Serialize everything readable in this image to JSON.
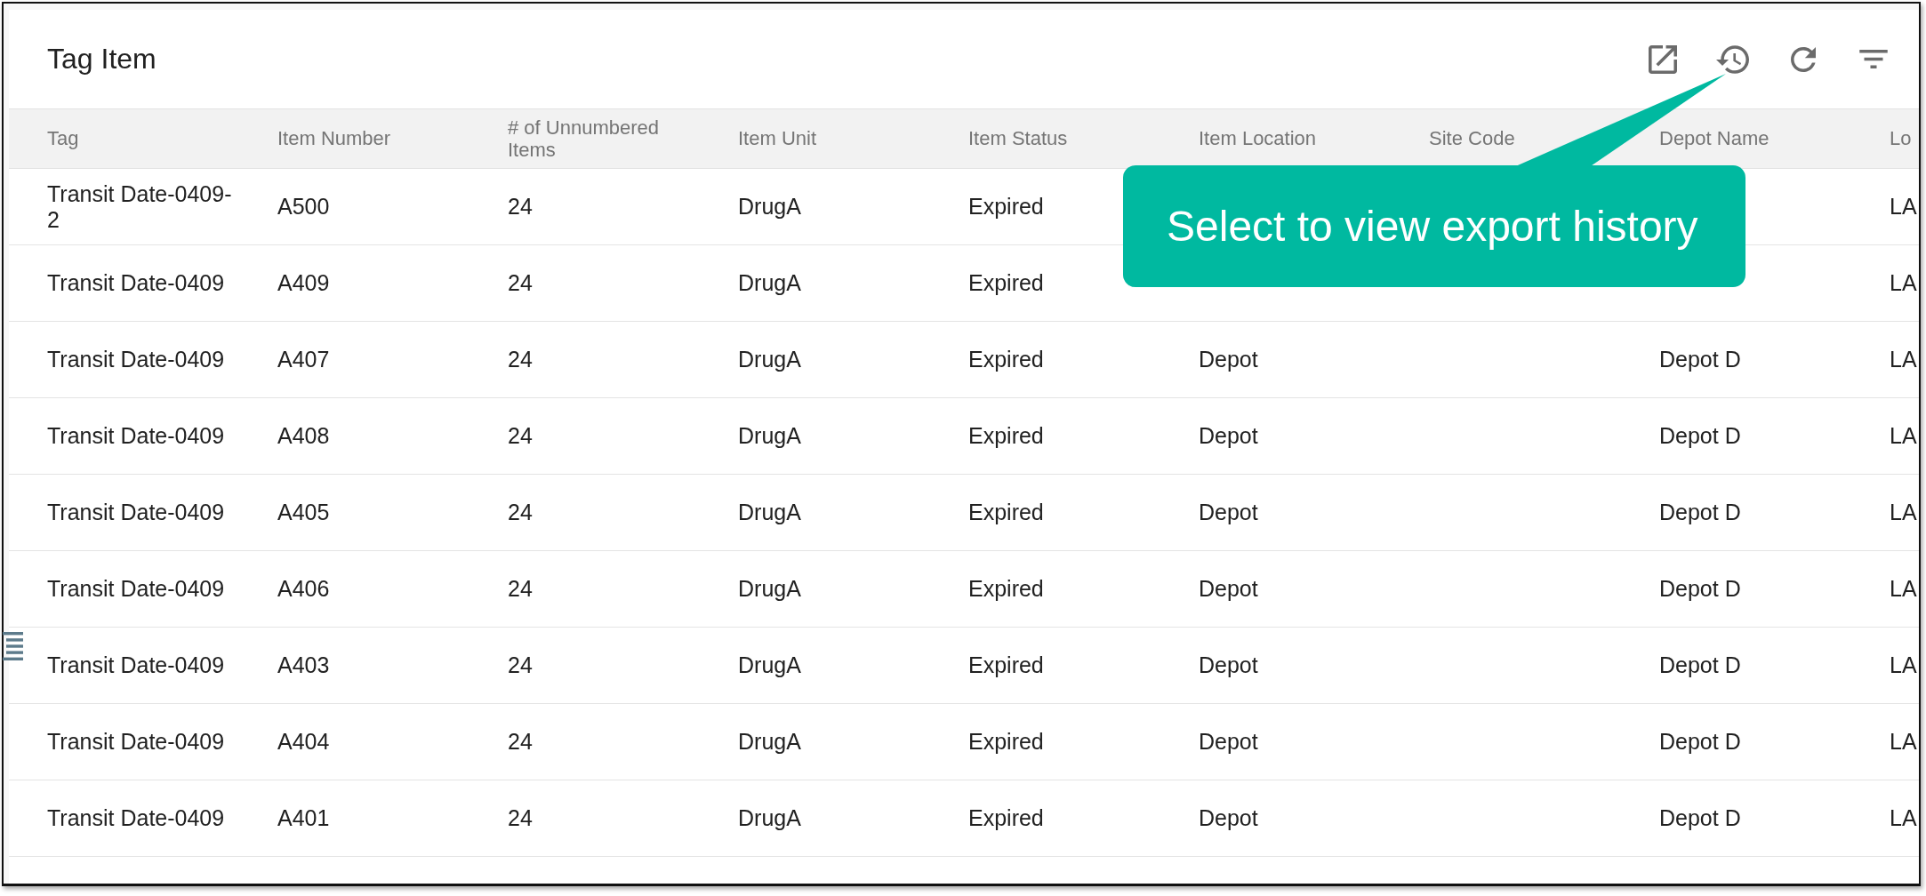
{
  "panel": {
    "title": "Tag Item"
  },
  "table": {
    "columns": [
      "Tag",
      "Item Number",
      "# of Unnumbered Items",
      "Item Unit",
      "Item Status",
      "Item Location",
      "Site Code",
      "Depot Name",
      "Lo"
    ],
    "rows": [
      {
        "tag": "Transit Date-0409-2",
        "item_number": "A500",
        "unnumbered_items": "24",
        "item_unit": "DrugA",
        "item_status": "Expired",
        "column_9": "LA"
      },
      {
        "tag": "Transit Date-0409",
        "item_number": "A409",
        "unnumbered_items": "24",
        "item_unit": "DrugA",
        "item_status": "Expired",
        "column_9": "LA"
      },
      {
        "tag": "Transit Date-0409",
        "item_number": "A407",
        "unnumbered_items": "24",
        "item_unit": "DrugA",
        "item_status": "Expired",
        "item_location": "Depot",
        "depot_name": "Depot D",
        "column_9": "LA"
      },
      {
        "tag": "Transit Date-0409",
        "item_number": "A408",
        "unnumbered_items": "24",
        "item_unit": "DrugA",
        "item_status": "Expired",
        "item_location": "Depot",
        "depot_name": "Depot D",
        "column_9": "LA"
      },
      {
        "tag": "Transit Date-0409",
        "item_number": "A405",
        "unnumbered_items": "24",
        "item_unit": "DrugA",
        "item_status": "Expired",
        "item_location": "Depot",
        "depot_name": "Depot D",
        "column_9": "LA"
      },
      {
        "tag": "Transit Date-0409",
        "item_number": "A406",
        "unnumbered_items": "24",
        "item_unit": "DrugA",
        "item_status": "Expired",
        "item_location": "Depot",
        "depot_name": "Depot D",
        "column_9": "LA"
      },
      {
        "tag": "Transit Date-0409",
        "item_number": "A403",
        "unnumbered_items": "24",
        "item_unit": "DrugA",
        "item_status": "Expired",
        "item_location": "Depot",
        "depot_name": "Depot D",
        "column_9": "LA"
      },
      {
        "tag": "Transit Date-0409",
        "item_number": "A404",
        "unnumbered_items": "24",
        "item_unit": "DrugA",
        "item_status": "Expired",
        "item_location": "Depot",
        "depot_name": "Depot D",
        "column_9": "LA"
      },
      {
        "tag": "Transit Date-0409",
        "item_number": "A401",
        "unnumbered_items": "24",
        "item_unit": "DrugA",
        "item_status": "Expired",
        "item_location": "Depot",
        "depot_name": "Depot D",
        "column_9": "LA"
      }
    ]
  },
  "callout": {
    "text": "Select to view export history"
  }
}
